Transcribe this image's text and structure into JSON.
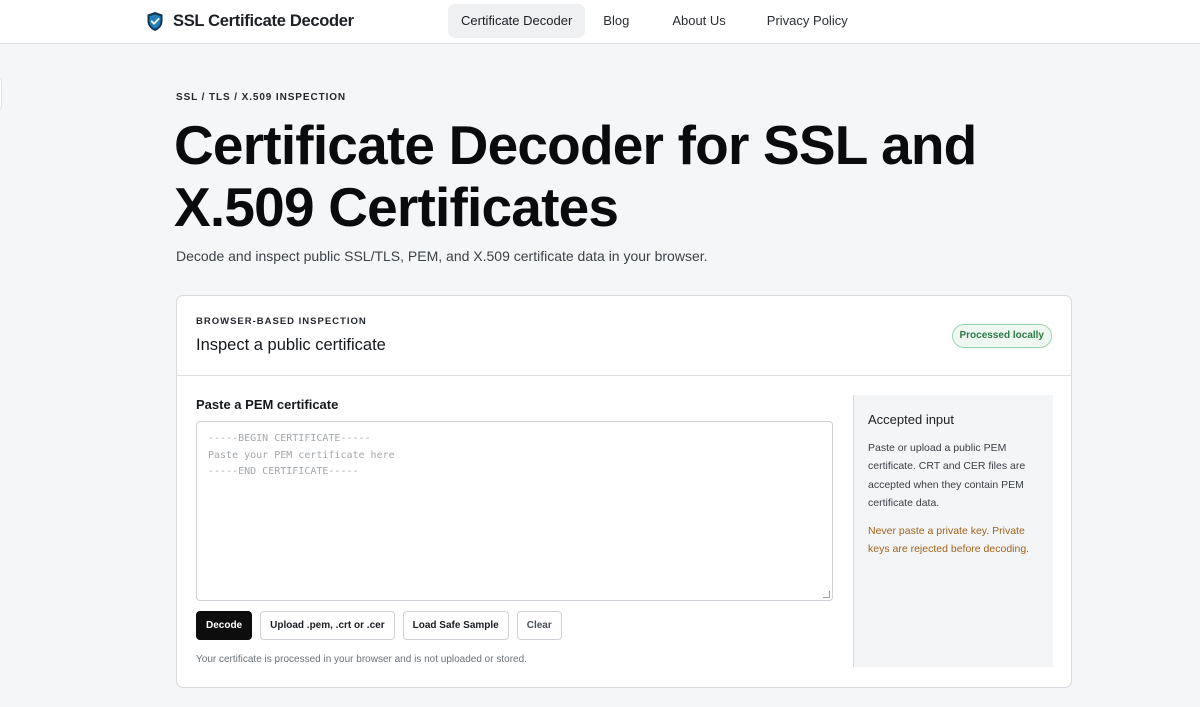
{
  "header": {
    "brand_name": "SSL Certificate Decoder",
    "logo_icon": "shield-check-icon",
    "nav": [
      {
        "label": "Certificate Decoder",
        "active": true
      },
      {
        "label": "Blog",
        "active": false
      },
      {
        "label": "About Us",
        "active": false
      },
      {
        "label": "Privacy Policy",
        "active": false
      }
    ]
  },
  "hero": {
    "eyebrow": "SSL / TLS / X.509 INSPECTION",
    "title": "Certificate Decoder for SSL and X.509 Certificates",
    "subtitle": "Decode and inspect public SSL/TLS, PEM, and X.509 certificate data in your browser."
  },
  "card": {
    "eyebrow": "BROWSER-BASED INSPECTION",
    "title": "Inspect a public certificate",
    "badge": "Processed locally",
    "field_label": "Paste a PEM certificate",
    "placeholder_lines": [
      "-----BEGIN CERTIFICATE-----",
      "Paste your PEM certificate here",
      "-----END CERTIFICATE-----"
    ],
    "buttons": {
      "decode": "Decode",
      "upload": "Upload .pem, .crt or .cer",
      "sample": "Load Safe Sample",
      "clear": "Clear"
    },
    "note": "Your certificate is processed in your browser and is not uploaded or stored.",
    "aside": {
      "title": "Accepted input",
      "body": "Paste or upload a public PEM certificate. CRT and CER files are accepted when they contain PEM certificate data.",
      "warning": "Never paste a private key. Private keys are rejected before decoding."
    }
  },
  "colors": {
    "primary_button": "#0d0d0d",
    "badge_green": "#2c7a45",
    "warning_amber": "#a2621b",
    "logo_blue": "#1f5f8b"
  }
}
